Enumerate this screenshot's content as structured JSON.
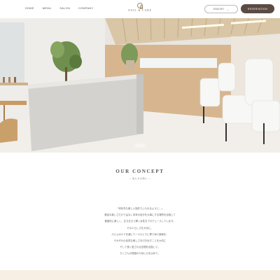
{
  "header": {
    "nav": [
      "HOME",
      "MENU",
      "SALON",
      "COMPANY"
    ],
    "logo_text": "NAIL & CARE",
    "language_label": "ENGLISH",
    "reserve_label": "RESERVATION"
  },
  "hero": {
    "caption": "PHOTO"
  },
  "concept": {
    "title": "OUR CONCEPT",
    "subtitle": "— 私たちの想い —",
    "lines": [
      "「何年先も美しい指先でいられるように…」",
      "美容の楽しさだけではなく本来の自分を大事にする場所を目指して",
      "健康的に美しく、生き生きと輝く女性をプロデュースしています。",
      "その人らしさを大切に。",
      "爪と心のケアを通じて一人ひとりに寄り添う施術を…",
      "それぞれの自然な美しさを引き出すことを大切に",
      "そして長く愛される空間を目指して。",
      "たくさんの笑顔のために心を込めて。"
    ]
  }
}
